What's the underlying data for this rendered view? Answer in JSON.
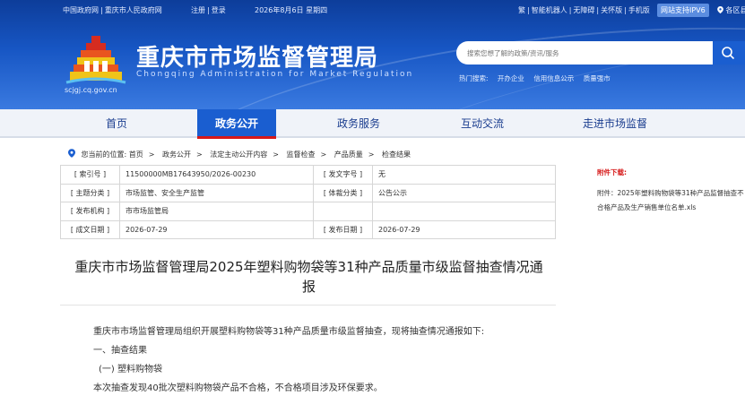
{
  "topbar": {
    "link_gov": "中国政府网",
    "link_cq": "重庆市人民政府网",
    "register": "注册",
    "login": "登录",
    "date": "2026年8月6日 星期四",
    "traditional": "繁",
    "robot": "智能机器人",
    "accessible": "无障碍",
    "care": "关怀版",
    "mobile": "手机版",
    "ipv6": "网站支持IPV6",
    "region": "各区县"
  },
  "brand": {
    "title": "重庆市市场监督管理局",
    "subtitle": "Chongqing Administration for Market Regulation",
    "domain": "scjgj.cq.gov.cn"
  },
  "search": {
    "placeholder": "搜索您想了解的政策/资讯/服务",
    "hot_label": "热门搜索:",
    "hot_terms": [
      "开办企业",
      "信用信息公示",
      "质量强市"
    ]
  },
  "nav": {
    "items": [
      "首页",
      "政务公开",
      "政务服务",
      "互动交流",
      "走进市场监督"
    ],
    "active": "政务公开"
  },
  "breadcrumb": {
    "prefix": "您当前的位置:",
    "items": [
      "首页",
      "政务公开",
      "法定主动公开内容",
      "监督检查",
      "产品质量",
      "检查结果"
    ]
  },
  "meta": {
    "index_no_label": "[ 索引号 ]",
    "index_no": "11500000MB17643950/2026-00230",
    "doc_no_label": "[ 发文字号 ]",
    "doc_no": "无",
    "topic_label": "[ 主题分类 ]",
    "topic": "市场监管、安全生产监管",
    "genre_label": "[ 体裁分类 ]",
    "genre": "公告公示",
    "issuer_label": "[ 发布机构 ]",
    "issuer": "市市场监管局",
    "created_label": "[ 成文日期 ]",
    "created": "2026-07-29",
    "published_label": "[ 发布日期 ]",
    "published": "2026-07-29"
  },
  "article": {
    "title": "重庆市市场监督管理局2025年塑料购物袋等31种产品质量市级监督抽查情况通报",
    "para1": "重庆市市场监督管理局组织开展塑料购物袋等31种产品质量市级监督抽查，现将抽查情况通报如下:",
    "heading1": "一、抽查结果",
    "heading2": "(一) 塑料购物袋",
    "para2": "本次抽查发现40批次塑料购物袋产品不合格，不合格项目涉及环保要求。"
  },
  "attachment": {
    "label": "附件下载:",
    "link": "附件：2025年塑料购物袋等31种产品监督抽查不合格产品及生产销售单位名单.xls"
  }
}
